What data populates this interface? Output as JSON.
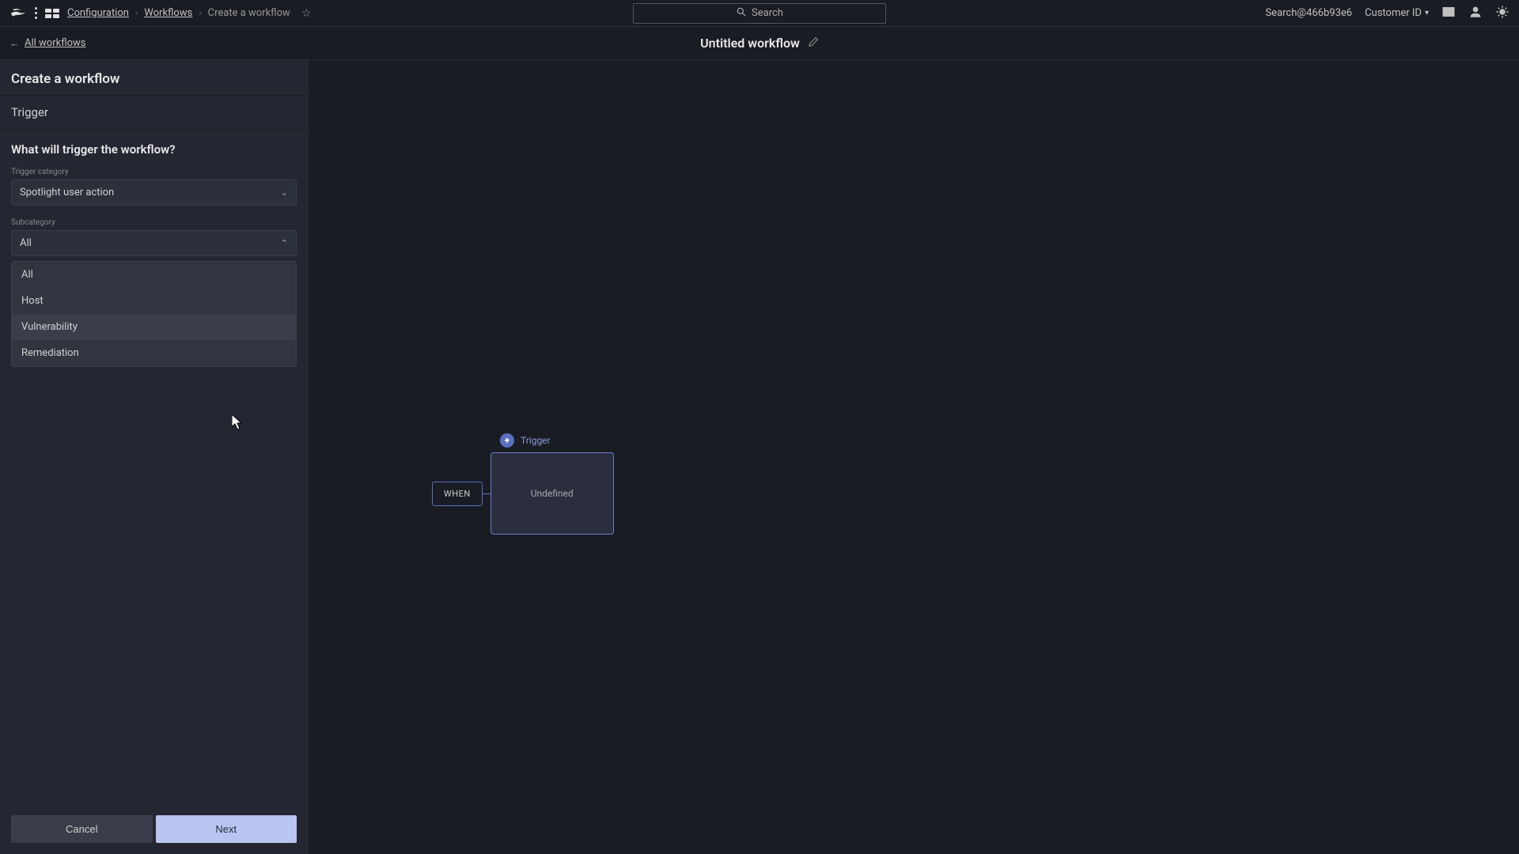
{
  "topbar": {
    "breadcrumb": {
      "item1": "Configuration",
      "item2": "Workflows",
      "current": "Create a workflow"
    },
    "search_placeholder": "Search",
    "account": "Search@466b93e6",
    "customer_label": "Customer ID"
  },
  "subheader": {
    "back_label": "All workflows",
    "title": "Untitled workflow"
  },
  "sidebar": {
    "header": "Create a workflow",
    "trigger_section": "Trigger",
    "question": "What will trigger the workflow?",
    "category": {
      "label": "Trigger category",
      "value": "Spotlight user action"
    },
    "subcategory": {
      "label": "Subcategory",
      "value": "All",
      "options": [
        "All",
        "Host",
        "Vulnerability",
        "Remediation"
      ]
    },
    "cancel": "Cancel",
    "next": "Next"
  },
  "canvas": {
    "trigger_label": "Trigger",
    "when": "WHEN",
    "node_status": "Undefined"
  }
}
